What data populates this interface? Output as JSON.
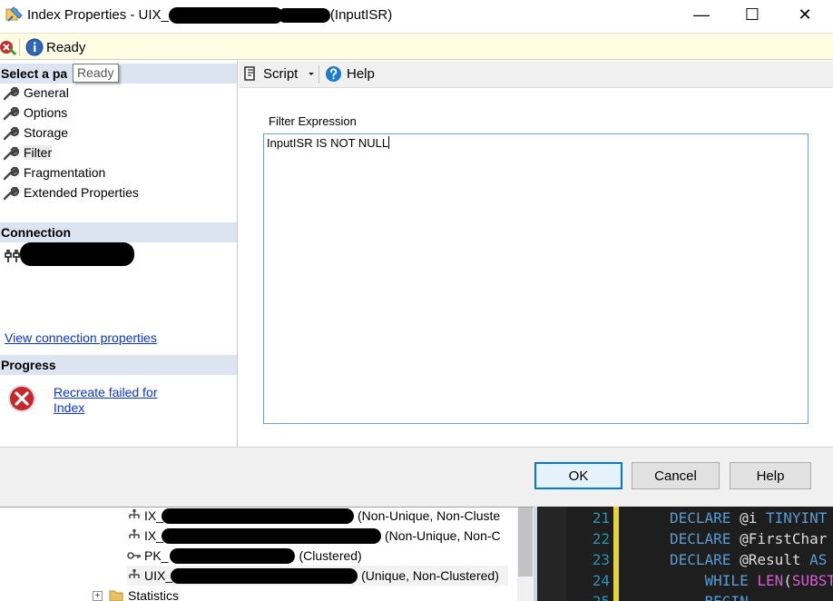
{
  "window": {
    "title_prefix": "Index Properties - UIX_",
    "title_suffix": "(InputISR)",
    "controls": {
      "minimize": "—",
      "maximize": "☐",
      "close": "✕"
    }
  },
  "status_bar": {
    "message": "Ready"
  },
  "left_panel": {
    "select_page_header": "Select a pa",
    "tooltip": "Ready",
    "pages": [
      "General",
      "Options",
      "Storage",
      "Filter",
      "Fragmentation",
      "Extended Properties"
    ],
    "selected_page": "Filter",
    "connection_header": "Connection",
    "view_connection_link": "View connection properties",
    "progress_header": "Progress",
    "progress_link_line1": "Recreate failed for",
    "progress_link_line2": "Index"
  },
  "toolbar": {
    "script_label": "Script",
    "help_label": "Help"
  },
  "filter": {
    "label": "Filter Expression",
    "expression": "InputISR IS NOT NULL"
  },
  "buttons": {
    "ok": "OK",
    "cancel": "Cancel",
    "help": "Help"
  },
  "explorer": {
    "rows": [
      {
        "prefix": "IX_",
        "suffix": "(Non-Unique, Non-Cluste",
        "icon": "index-icon"
      },
      {
        "prefix": "IX_",
        "suffix": "(Non-Unique, Non-C",
        "icon": "index-icon"
      },
      {
        "prefix": "PK_",
        "suffix": "(Clustered)",
        "icon": "key-icon"
      },
      {
        "prefix": "UIX_",
        "suffix": "(Unique, Non-Clustered)",
        "icon": "index-icon"
      }
    ],
    "statistics_label": "Statistics",
    "expander": "+"
  },
  "editor": {
    "lines": [
      {
        "num": "21",
        "tokens": [
          [
            "kw",
            "DECLARE "
          ],
          [
            "",
            "@i "
          ],
          [
            "ty",
            "TINYINT"
          ]
        ]
      },
      {
        "num": "22",
        "tokens": [
          [
            "kw",
            "DECLARE "
          ],
          [
            "",
            "@FirstChar"
          ]
        ]
      },
      {
        "num": "23",
        "tokens": [
          [
            "kw",
            "DECLARE "
          ],
          [
            "",
            "@Result "
          ],
          [
            "kw",
            "AS"
          ]
        ]
      },
      {
        "num": "24",
        "tokens": [
          [
            "",
            "    "
          ],
          [
            "kw",
            "WHILE "
          ],
          [
            "fn",
            "LEN"
          ],
          [
            "",
            "("
          ],
          [
            "fn",
            "SUBST"
          ]
        ]
      },
      {
        "num": "25",
        "tokens": [
          [
            "",
            "    "
          ],
          [
            "kw",
            "BEGIN"
          ]
        ]
      }
    ]
  },
  "colors": {
    "status_bg": "#fffde3",
    "section_header_bg": "#dbe4f0",
    "link": "#0b35d6",
    "default_button_border": "#0078d7",
    "editor_bg": "#1e1e1e"
  }
}
